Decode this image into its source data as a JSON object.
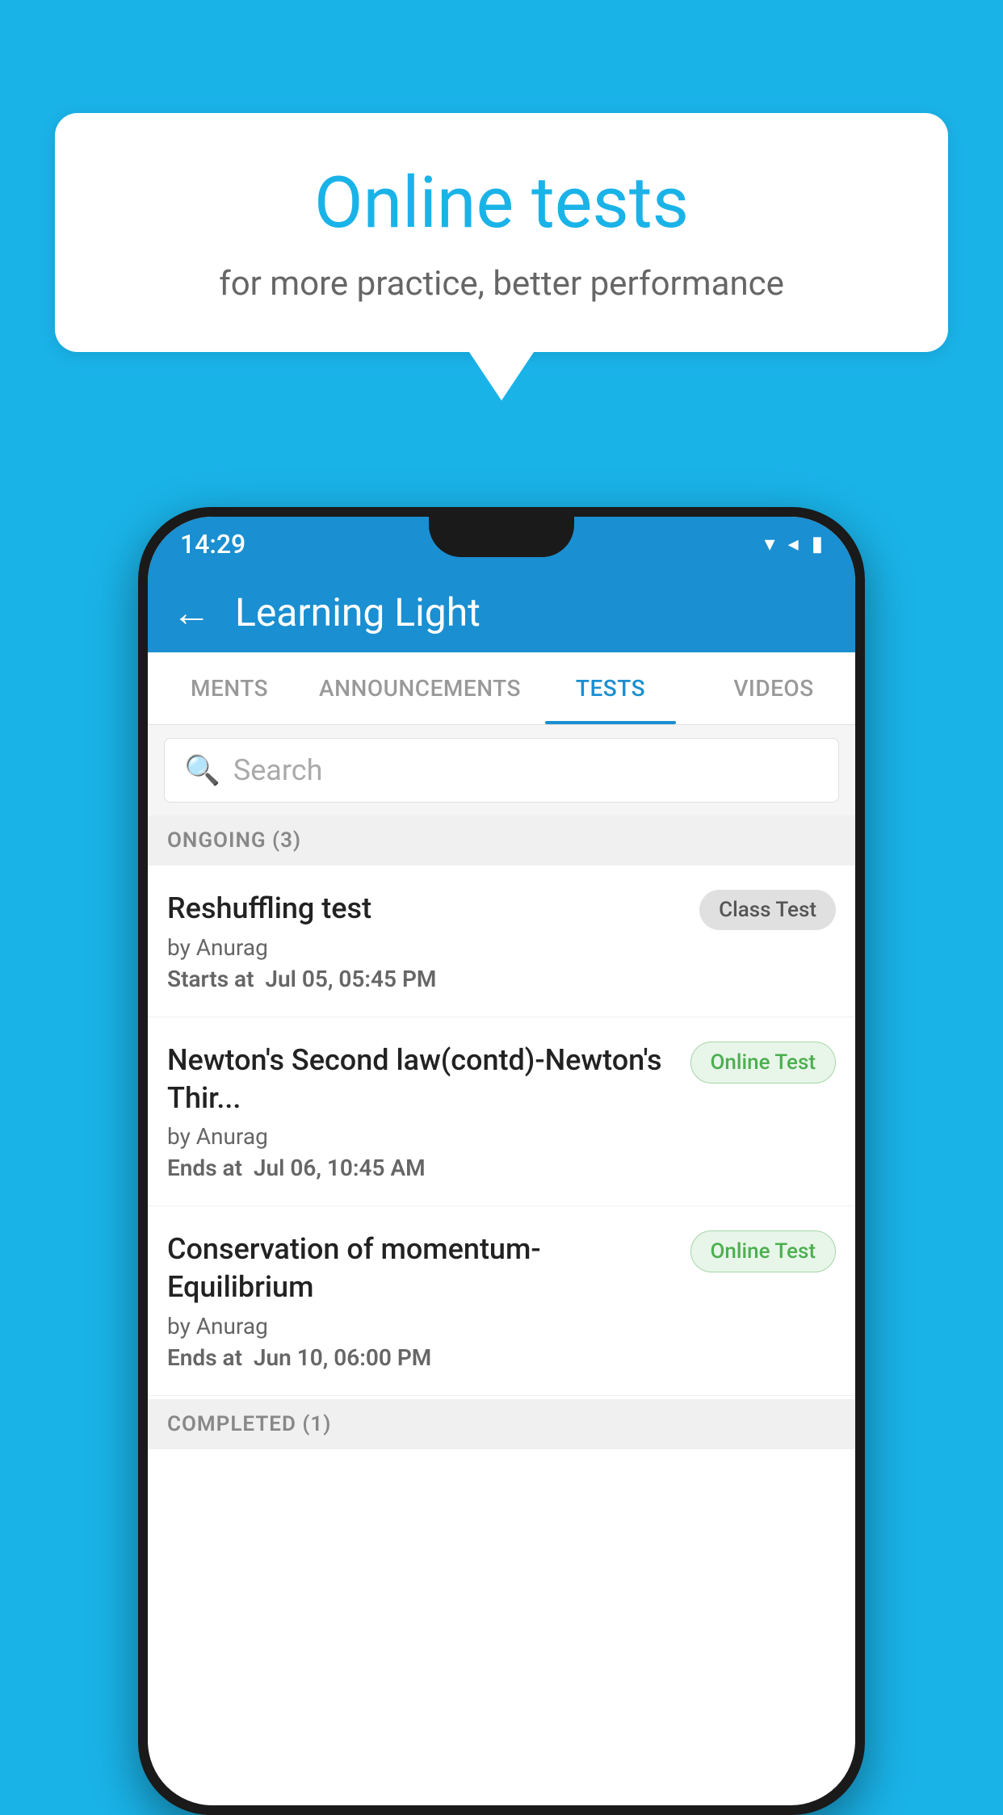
{
  "background": {
    "color": "#1ab3e8"
  },
  "speech_bubble": {
    "title": "Online tests",
    "subtitle": "for more practice, better performance"
  },
  "phone": {
    "status_bar": {
      "time": "14:29",
      "icons": [
        "wifi",
        "signal",
        "battery"
      ]
    },
    "app_bar": {
      "back_label": "←",
      "title": "Learning Light"
    },
    "tabs": [
      {
        "label": "MENTS",
        "active": false
      },
      {
        "label": "ANNOUNCEMENTS",
        "active": false
      },
      {
        "label": "TESTS",
        "active": true
      },
      {
        "label": "VIDEOS",
        "active": false
      }
    ],
    "search": {
      "placeholder": "Search"
    },
    "ongoing_section": {
      "title": "ONGOING (3)"
    },
    "tests": [
      {
        "name": "Reshuffling test",
        "author": "by Anurag",
        "time_label": "Starts at",
        "time_value": "Jul 05, 05:45 PM",
        "badge": "Class Test",
        "badge_type": "gray"
      },
      {
        "name": "Newton's Second law(contd)-Newton's Thir...",
        "author": "by Anurag",
        "time_label": "Ends at",
        "time_value": "Jul 06, 10:45 AM",
        "badge": "Online Test",
        "badge_type": "green"
      },
      {
        "name": "Conservation of momentum-Equilibrium",
        "author": "by Anurag",
        "time_label": "Ends at",
        "time_value": "Jun 10, 06:00 PM",
        "badge": "Online Test",
        "badge_type": "green"
      }
    ],
    "completed_section": {
      "title": "COMPLETED (1)"
    }
  }
}
